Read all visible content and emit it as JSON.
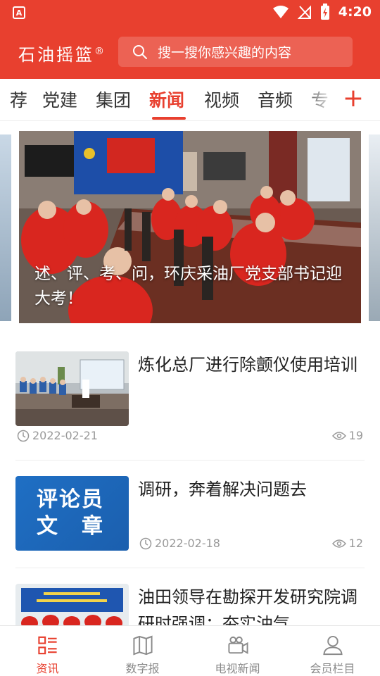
{
  "status_bar": {
    "time": "4:20",
    "app_icon_letter": "A"
  },
  "header": {
    "brand": "石油摇篮",
    "brand_mark": "®",
    "search_placeholder": "搜一搜你感兴趣的内容"
  },
  "tabs": [
    {
      "label": "荐"
    },
    {
      "label": "党建"
    },
    {
      "label": "集团"
    },
    {
      "label": "新闻",
      "active": true
    },
    {
      "label": "视频"
    },
    {
      "label": "音频"
    },
    {
      "label": "专"
    }
  ],
  "add_tab_symbol": "+",
  "carousel": {
    "caption": "述、评、考、问，环庆采油厂党支部书记迎大考！"
  },
  "news": [
    {
      "title": "炼化总厂进行除颤仪使用培训",
      "date": "2022-02-21",
      "views": "19"
    },
    {
      "title": "调研，奔着解决问题去",
      "date": "2022-02-18",
      "views": "12",
      "thumb_text_line1": "评论员",
      "thumb_text_line2": "文　章"
    },
    {
      "title": "油田领导在勘探开发研究院调研时强调：夯实油气"
    }
  ],
  "bottom_nav": [
    {
      "label": "资讯",
      "icon": "news-list-icon",
      "active": true
    },
    {
      "label": "数字报",
      "icon": "newspaper-icon"
    },
    {
      "label": "电视新闻",
      "icon": "video-camera-icon"
    },
    {
      "label": "会员栏目",
      "icon": "user-icon"
    }
  ],
  "colors": {
    "brand_red": "#e8402f",
    "meta_gray": "#999999"
  }
}
